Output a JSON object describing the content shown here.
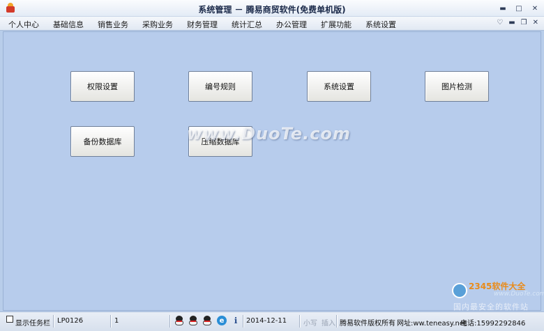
{
  "window": {
    "title": "系统管理 － 腾易商贸软件(免费单机版)"
  },
  "menu": {
    "items": [
      "个人中心",
      "基础信息",
      "销售业务",
      "采购业务",
      "财务管理",
      "统计汇总",
      "办公管理",
      "扩展功能",
      "系统设置"
    ]
  },
  "buttons": {
    "permission": "权限设置",
    "numbering": "编号规则",
    "system": "系统设置",
    "image_check": "图片检测",
    "backup": "备份数据库",
    "compress": "压缩数据库"
  },
  "watermark": {
    "text": "www.DuoTe.com",
    "brand": "2345软件大全",
    "url": "www.DuoTe.com",
    "slogan": "国内最安全的软件站"
  },
  "status": {
    "show_taskbar": "显示任务栏",
    "code": "LP0126",
    "count": "1",
    "date": "2014-12-11",
    "caps": "小写",
    "insert": "插入",
    "copyright": "腾易软件版权所有",
    "website": "网址:ww.teneasy.net",
    "phone": "电话:15992292846"
  },
  "icons": {
    "app": "app-icon",
    "qq": "qq-icon",
    "ie": "browser-icon",
    "info": "info-icon"
  }
}
